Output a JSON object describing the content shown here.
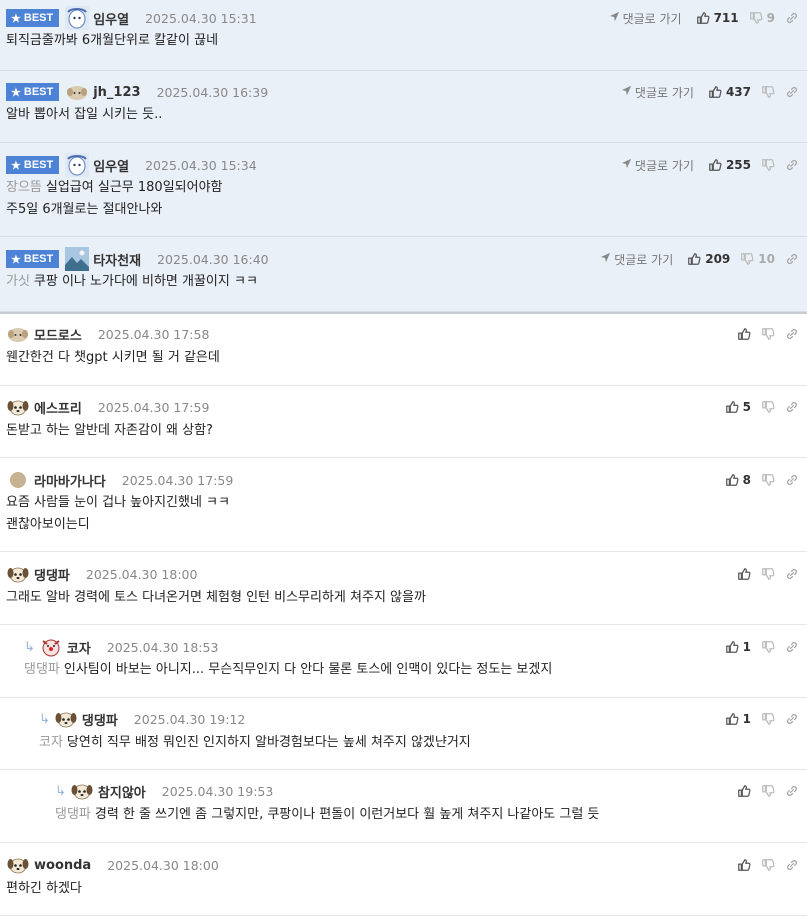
{
  "comments": [
    {
      "best": true,
      "badge": "BEST",
      "avatar": "sheep-blue",
      "nick": "임우열",
      "date": "2025.04.30 15:31",
      "goto": "댓글로 가기",
      "likes": "711",
      "dislikes": "9",
      "mention": "",
      "lines": [
        "퇴직금줄까봐 6개월단위로 칼같이 끊네"
      ]
    },
    {
      "best": true,
      "badge": "BEST",
      "avatar": "puppy-tan",
      "nick": "jh_123",
      "date": "2025.04.30 16:39",
      "goto": "댓글로 가기",
      "likes": "437",
      "dislikes": "",
      "mention": "",
      "lines": [
        "알바 뽑아서 잡일 시키는 듯.."
      ]
    },
    {
      "best": true,
      "badge": "BEST",
      "avatar": "sheep-blue",
      "nick": "임우열",
      "date": "2025.04.30 15:34",
      "goto": "댓글로 가기",
      "likes": "255",
      "dislikes": "",
      "mention": "장으뜸",
      "lines": [
        "실업급여 실근무 180일되어야함",
        "주5일 6개월로는 절대안나와"
      ]
    },
    {
      "best": true,
      "badge": "BEST",
      "avatar": "landscape",
      "nick": "타자천재",
      "date": "2025.04.30 16:40",
      "goto": "댓글로 가기",
      "likes": "209",
      "dislikes": "10",
      "mention": "가싯",
      "lines": [
        "쿠팡 이나 노가다에 비하면 개꿀이지 ㅋㅋ"
      ]
    },
    {
      "best": false,
      "avatar": "puppy-tan",
      "nick": "모드로스",
      "date": "2025.04.30 17:58",
      "likes": "",
      "dislikes": "",
      "mention": "",
      "lines": [
        "웬간한건 다 챗gpt 시키면 될 거 같은데"
      ]
    },
    {
      "best": false,
      "avatar": "dog-face",
      "nick": "에스프리",
      "date": "2025.04.30 17:59",
      "likes": "5",
      "dislikes": "",
      "mention": "",
      "lines": [
        "돈받고 하는 알반데 자존감이 왜 상함?"
      ]
    },
    {
      "best": false,
      "avatar": "circle-tan",
      "nick": "라마바가나다",
      "date": "2025.04.30 17:59",
      "likes": "8",
      "dislikes": "",
      "mention": "",
      "lines": [
        "요즘 사람들 눈이 겁나 높아지긴했네 ㅋㅋ",
        "괜찮아보이는디"
      ]
    },
    {
      "best": false,
      "avatar": "dog-face",
      "nick": "댕댕파",
      "date": "2025.04.30 18:00",
      "likes": "",
      "dislikes": "",
      "mention": "",
      "lines": [
        "그래도 알바 경력에 토스 다녀온거면 체험형 인턴 비스무리하게 쳐주지 않을까"
      ]
    },
    {
      "best": false,
      "reply": true,
      "avatar": "clown",
      "nick": "코자",
      "date": "2025.04.30 18:53",
      "likes": "1",
      "dislikes": "",
      "mention": "댕댕파",
      "lines": [
        "인사팀이 바보는 아니지... 무슨직무인지 다 안다 물론 토스에 인맥이 있다는 정도는 보겠지"
      ]
    },
    {
      "best": false,
      "reply": true,
      "avatar": "dog-face",
      "nick": "댕댕파",
      "date": "2025.04.30 19:12",
      "likes": "1",
      "dislikes": "",
      "mention": "코자",
      "lines": [
        "당연히 직무 배정 뭐인진 인지하지 알바경험보다는 높세 쳐주지 않겠냔거지"
      ]
    },
    {
      "best": false,
      "reply": true,
      "avatar": "dog-face",
      "nick": "참지않아",
      "date": "2025.04.30 19:53",
      "likes": "",
      "dislikes": "",
      "mention": "댕댕파",
      "lines": [
        "경력 한 줄 쓰기엔 좀 그렇지만, 쿠팡이나 편돌이 이런거보다 훨 높게 쳐주지 나같아도 그럴 듯"
      ]
    },
    {
      "best": false,
      "avatar": "dog-face",
      "nick": "woonda",
      "date": "2025.04.30 18:00",
      "likes": "",
      "dislikes": "",
      "mention": "",
      "lines": [
        "편하긴 하겠다"
      ]
    }
  ]
}
